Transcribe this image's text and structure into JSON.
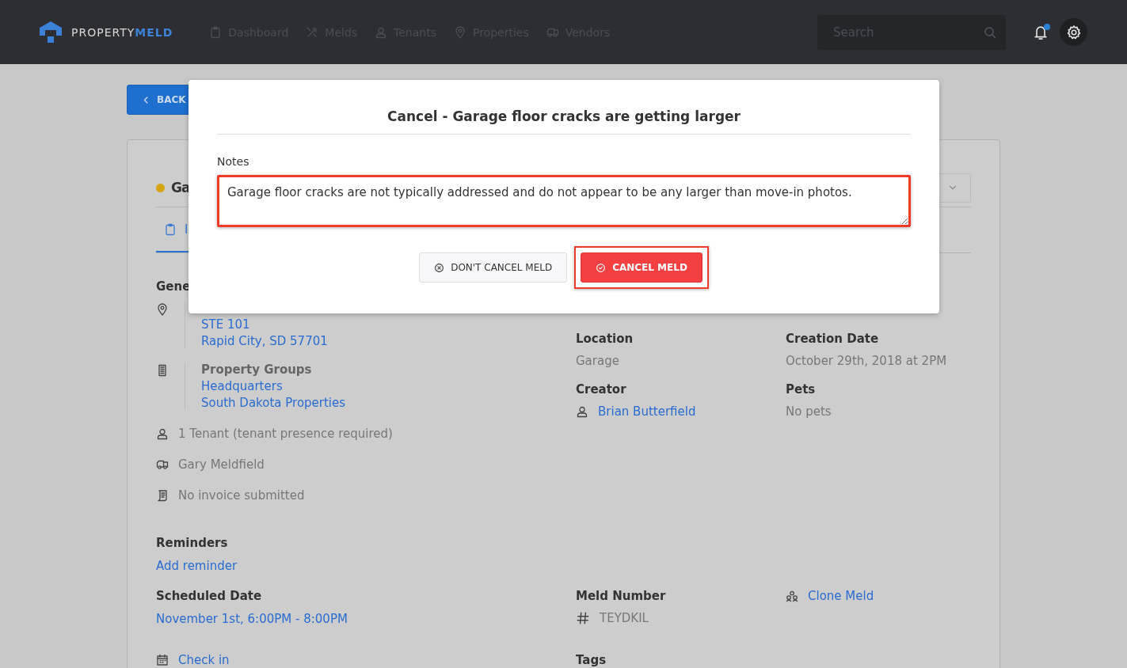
{
  "navbar": {
    "logo": {
      "light": "PROPERTY",
      "bold": "MELD"
    },
    "items": [
      {
        "label": "Dashboard"
      },
      {
        "label": "Melds"
      },
      {
        "label": "Tenants"
      },
      {
        "label": "Properties"
      },
      {
        "label": "Vendors"
      }
    ],
    "search": {
      "placeholder": "Search"
    },
    "notifications": {
      "unread": true
    }
  },
  "back_button": {
    "label": "BACK"
  },
  "meld": {
    "title": "Ga",
    "tab": {
      "label": "I",
      "selected": true
    },
    "section_heading": "Gene",
    "address": [
      "STE 101",
      "Rapid City, SD 57701"
    ],
    "property_groups": {
      "heading": "Property Groups",
      "items": [
        "Headquarters",
        "South Dakota Properties"
      ]
    },
    "tenants": "1 Tenant (tenant presence required)",
    "vendor": "Gary Meldfield",
    "invoice": "No invoice submitted",
    "reminders": {
      "heading": "Reminders",
      "action": "Add reminder"
    },
    "location": {
      "label": "Location",
      "value": "Garage"
    },
    "creation_date": {
      "label": "Creation Date",
      "value": "October 29th, 2018 at 2PM"
    },
    "creator": {
      "label": "Creator",
      "value": "Brian Butterfield"
    },
    "pets": {
      "label": "Pets",
      "value": "No pets"
    },
    "scheduled_date": {
      "label": "Scheduled Date",
      "value": "November 1st, 6:00PM - 8:00PM"
    },
    "meld_number": {
      "label": "Meld Number",
      "value": "TEYDKIL"
    },
    "clone_action": "Clone Meld",
    "check_in": "Check in",
    "tags_label": "Tags"
  },
  "modal": {
    "title": "Cancel - Garage floor cracks are getting larger",
    "notes_label": "Notes",
    "notes_value": "Garage floor cracks are not typically addressed and do not appear to be any larger than move-in photos.",
    "notes_highlighted": true,
    "buttons": [
      {
        "label": "DON'T CANCEL MELD",
        "kind": "secondary",
        "highlighted": false
      },
      {
        "label": "CANCEL MELD",
        "kind": "danger",
        "highlighted": true
      }
    ]
  }
}
